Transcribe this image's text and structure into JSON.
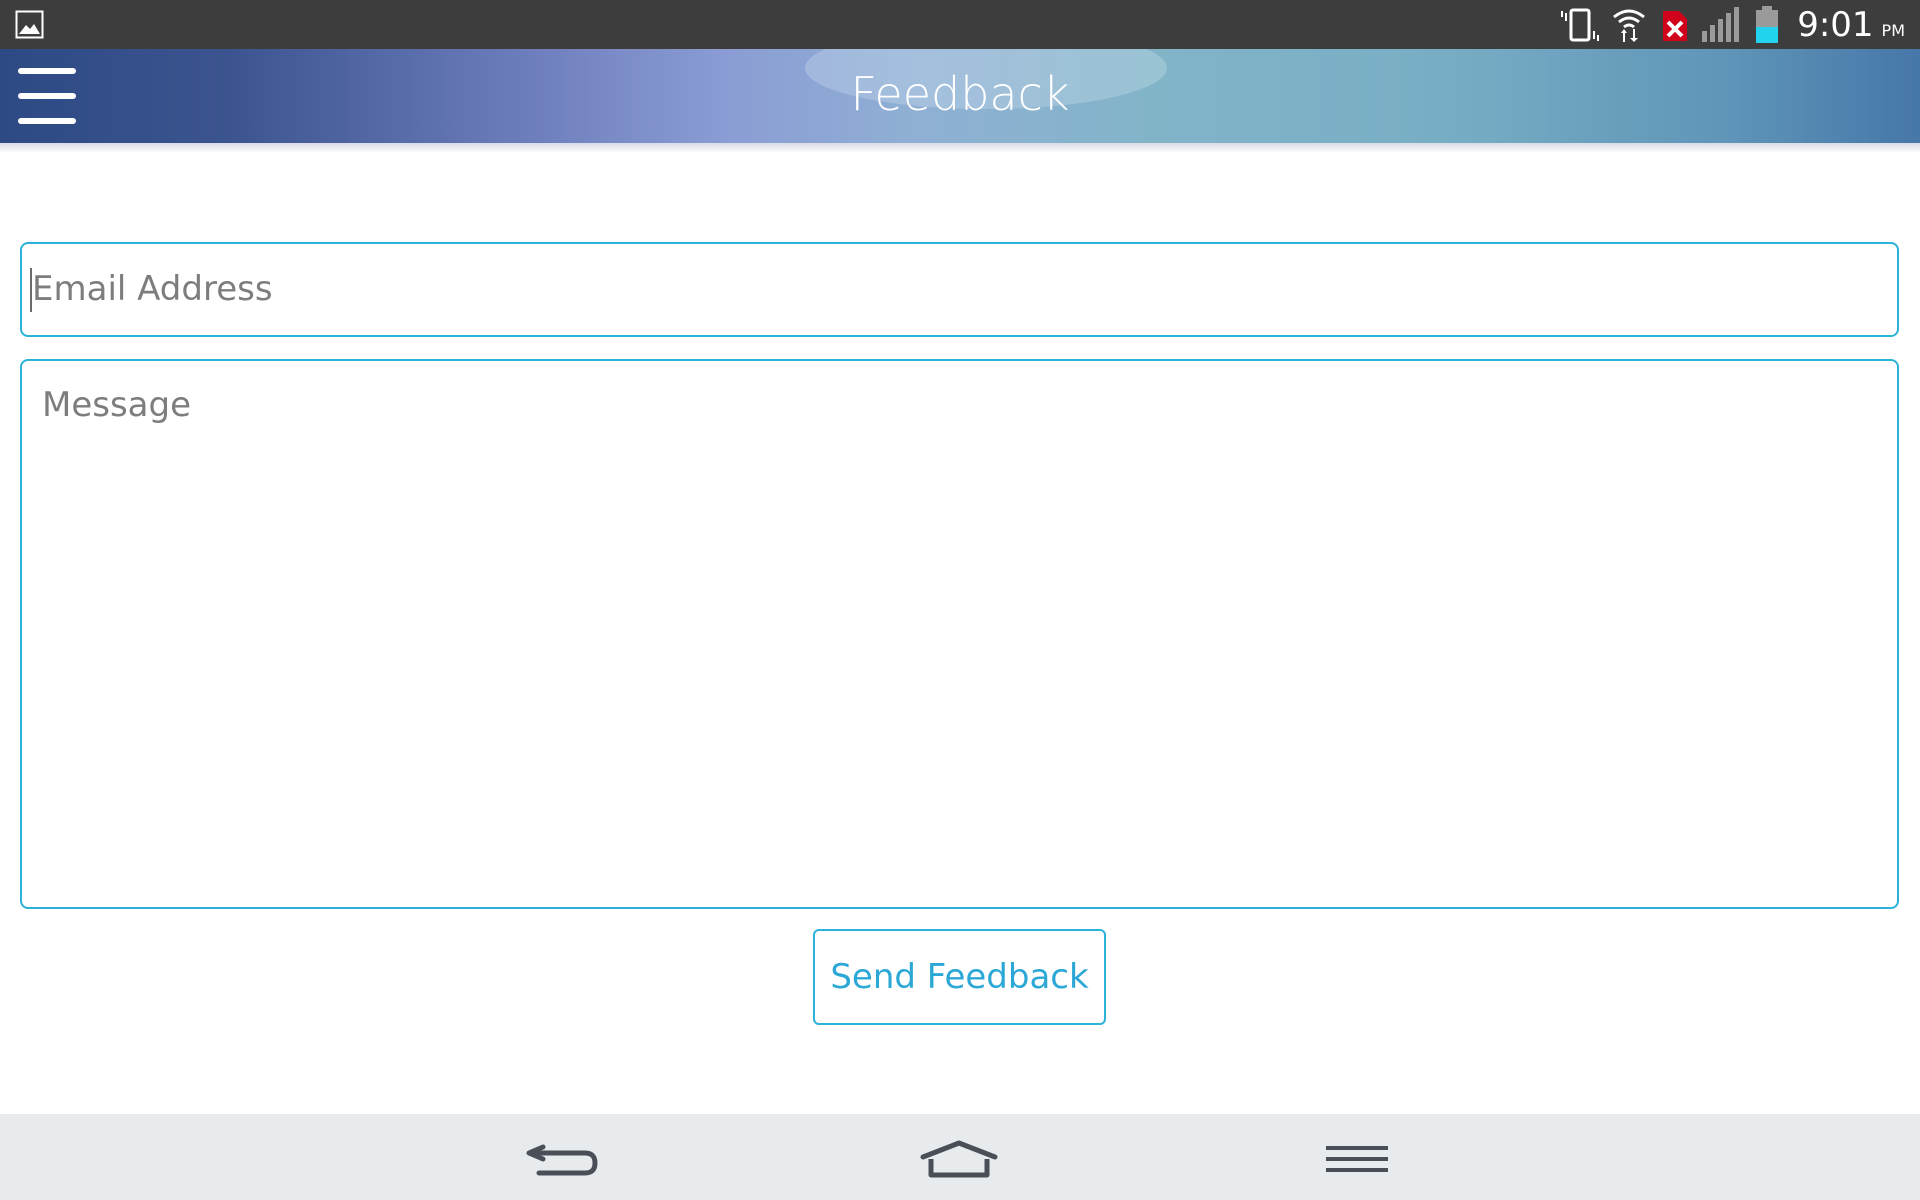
{
  "status_bar": {
    "left_icon": "gallery-notification-icon",
    "icons": [
      "vibrate-icon",
      "wifi-icon",
      "sync-error-icon",
      "signal-icon",
      "battery-icon"
    ],
    "time": "9:01",
    "ampm": "PM"
  },
  "header": {
    "title": "Feedback",
    "menu_icon": "hamburger-menu-icon"
  },
  "form": {
    "email_placeholder": "Email Address",
    "message_placeholder": "Message",
    "send_label": "Send Feedback"
  },
  "nav_bar": {
    "buttons": [
      "back-icon",
      "home-icon",
      "menu-icon"
    ]
  },
  "colors": {
    "accent": "#2db3d9",
    "status_bar": "#3d3d3d",
    "nav_bar": "#e7ebee",
    "placeholder_text": "#7d7d7d",
    "sync_error": "#d0021b",
    "battery_fill": "#22d3ee"
  }
}
